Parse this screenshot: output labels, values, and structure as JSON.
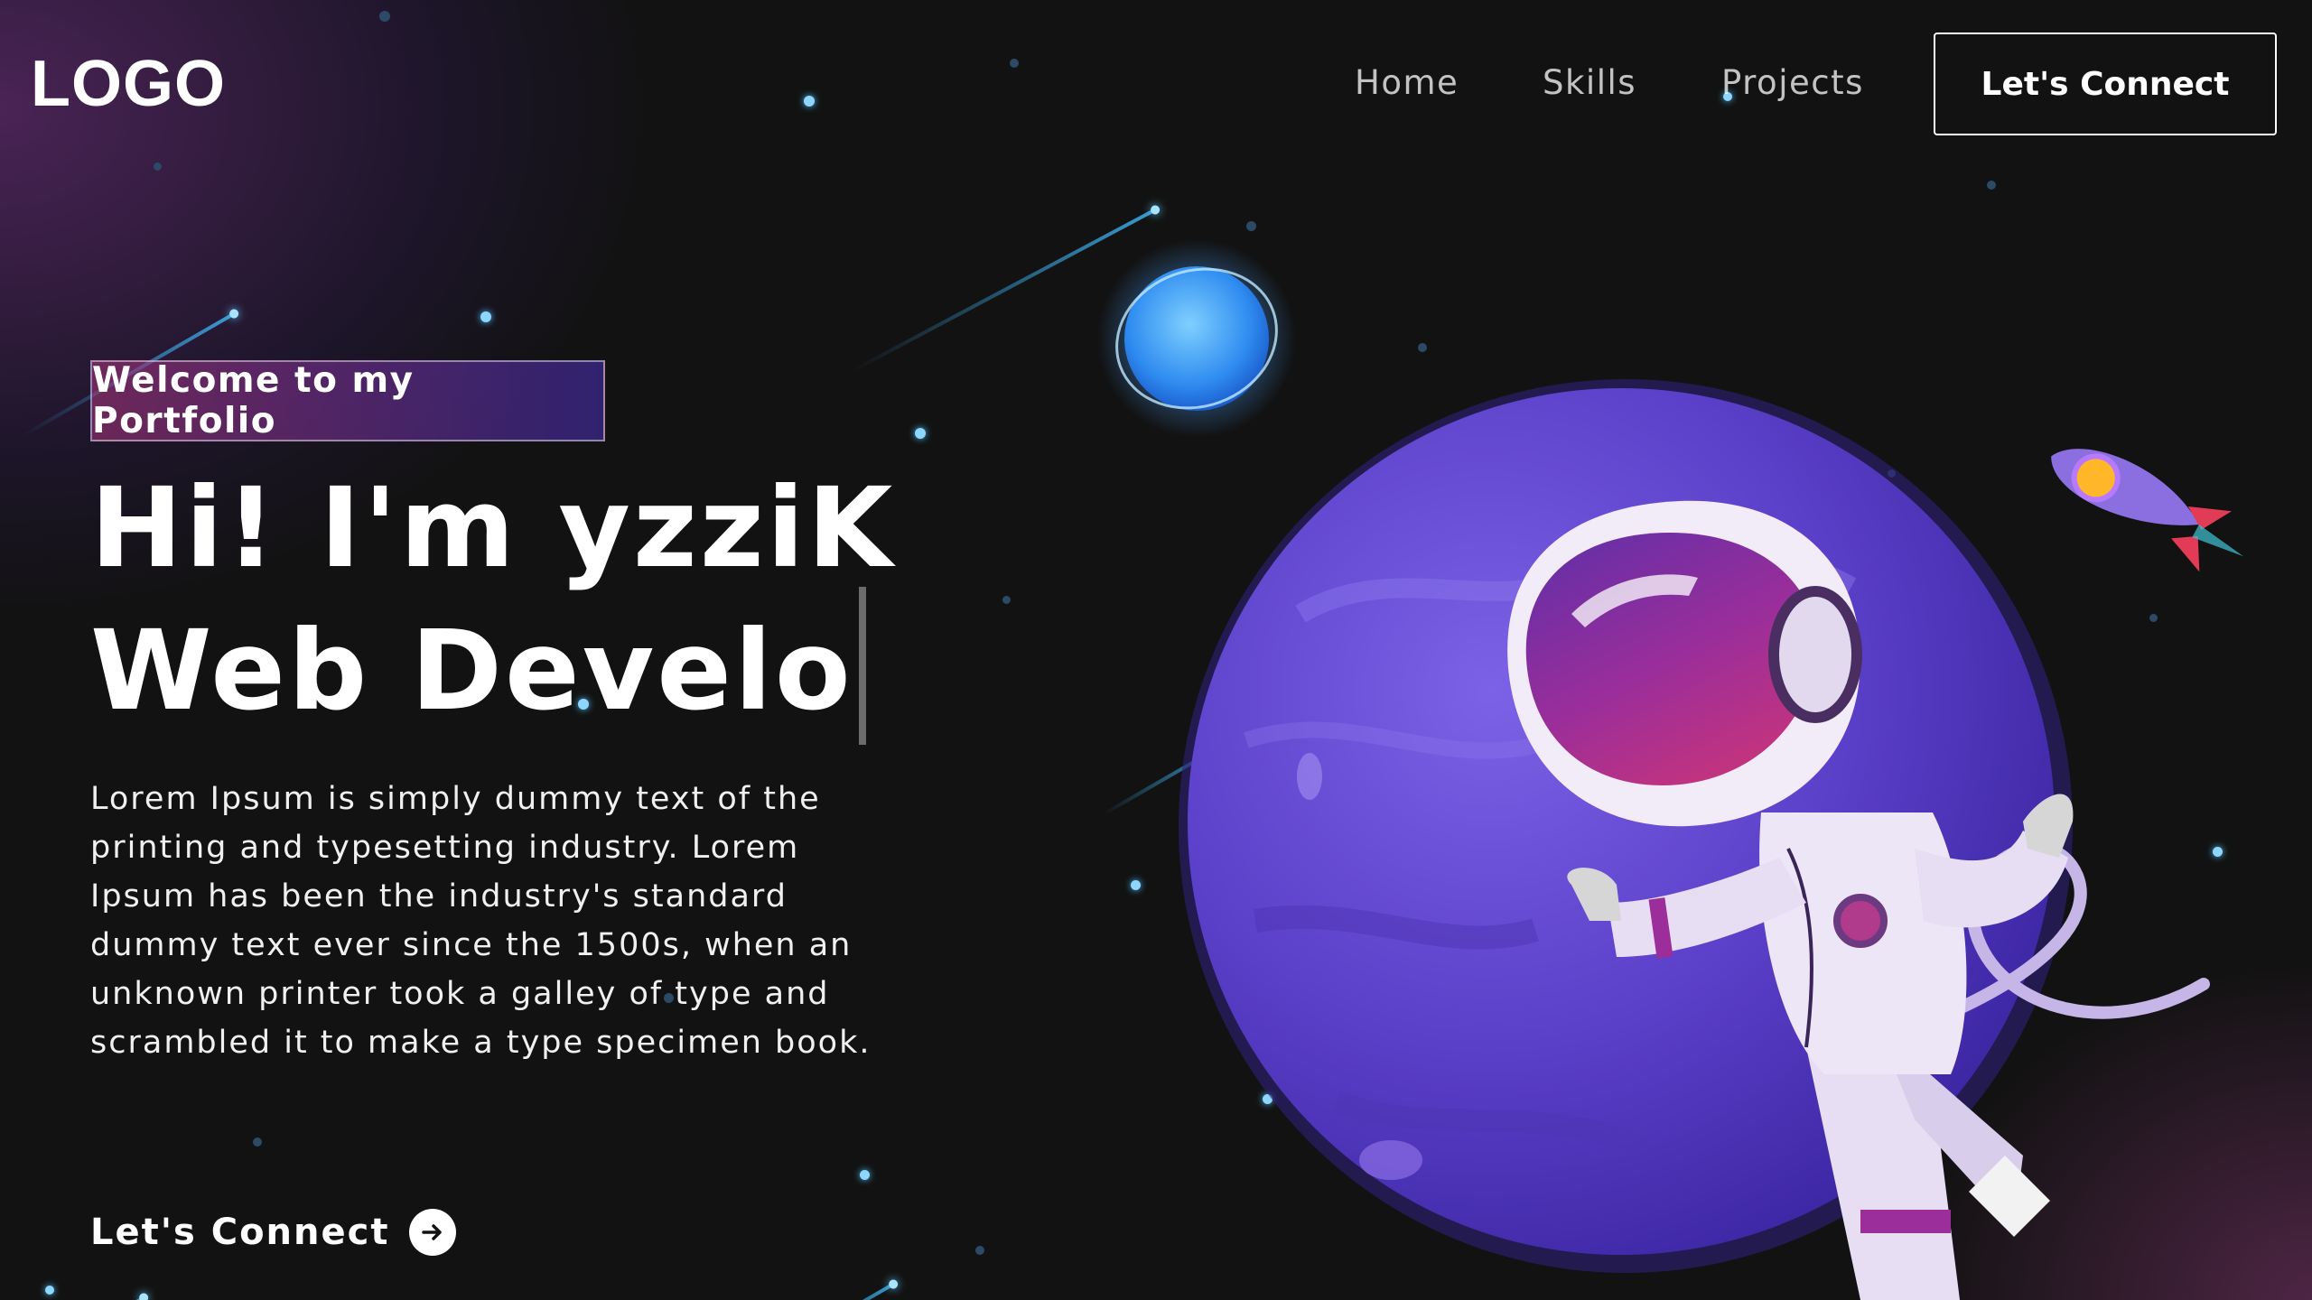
{
  "nav": {
    "logo": "LOGO",
    "links": [
      "Home",
      "Skills",
      "Projects"
    ],
    "connect_button": "Let's Connect"
  },
  "hero": {
    "tagline": "Welcome to my Portfolio",
    "headline_line1": "Hi! I'm yzziK",
    "headline_line2": "Web Develo",
    "description": "Lorem Ipsum is simply dummy text of the printing and typesetting industry. Lorem Ipsum has been the industry's standard dummy text ever since the 1500s, when an unknown printer took a galley of type and scrambled it to make a type specimen book.",
    "cta_label": "Let's Connect"
  },
  "icons": {
    "cta": "arrow-right-circle-icon"
  },
  "colors": {
    "background": "#121212",
    "tagline_gradient_start": "#aa367c",
    "tagline_gradient_end": "#4a2fbd",
    "planet": "#5f3fd0",
    "accent_star": "#8fd6ff"
  }
}
